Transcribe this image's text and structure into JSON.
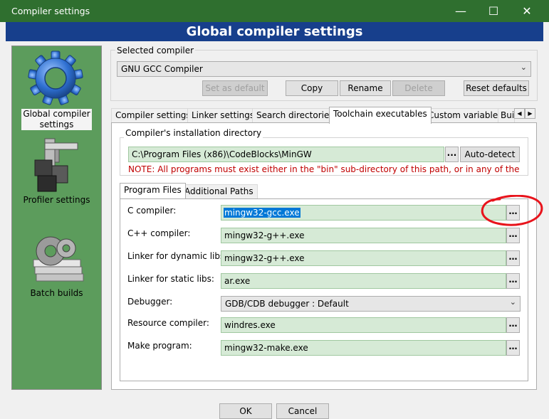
{
  "window": {
    "title": "Compiler settings",
    "min_glyph": "—",
    "max_glyph": "☐",
    "close_glyph": "✕"
  },
  "banner": "Global compiler settings",
  "sidebar": {
    "items": [
      {
        "label_line1": "Global compiler",
        "label_line2": "settings",
        "icon": "gear-icon"
      },
      {
        "label": "Profiler settings",
        "icon": "caliper-icon"
      },
      {
        "label": "Batch builds",
        "icon": "batch-icon"
      }
    ]
  },
  "selected_compiler": {
    "group_label": "Selected compiler",
    "value": "GNU GCC Compiler",
    "buttons": {
      "set_default": "Set as default",
      "copy": "Copy",
      "rename": "Rename",
      "delete": "Delete",
      "reset": "Reset defaults"
    }
  },
  "tabs": [
    "Compiler settings",
    "Linker settings",
    "Search directories",
    "Toolchain executables",
    "Custom variables",
    "Bui"
  ],
  "install_dir": {
    "group_label": "Compiler's installation directory",
    "value": "C:\\Program Files (x86)\\CodeBlocks\\MinGW",
    "browse": "...",
    "auto_detect": "Auto-detect",
    "note": "NOTE: All programs must exist either in the \"bin\" sub-directory of this path, or in any of the"
  },
  "subtabs": [
    "Program Files",
    "Additional Paths"
  ],
  "programs": [
    {
      "label": "C compiler:",
      "value": "mingw32-gcc.exe"
    },
    {
      "label": "C++ compiler:",
      "value": "mingw32-g++.exe"
    },
    {
      "label": "Linker for dynamic libs:",
      "value": "mingw32-g++.exe"
    },
    {
      "label": "Linker for static libs:",
      "value": "ar.exe"
    },
    {
      "label": "Debugger:",
      "value": "GDB/CDB debugger : Default"
    },
    {
      "label": "Resource compiler:",
      "value": "windres.exe"
    },
    {
      "label": "Make program:",
      "value": "mingw32-make.exe"
    }
  ],
  "dialog_buttons": {
    "ok": "OK",
    "cancel": "Cancel"
  },
  "colors": {
    "titlebar": "#2f6f2f",
    "banner": "#173f8c",
    "sidebar": "#5c9c5c",
    "field": "#d6ead6",
    "annotation": "#e8141c"
  }
}
